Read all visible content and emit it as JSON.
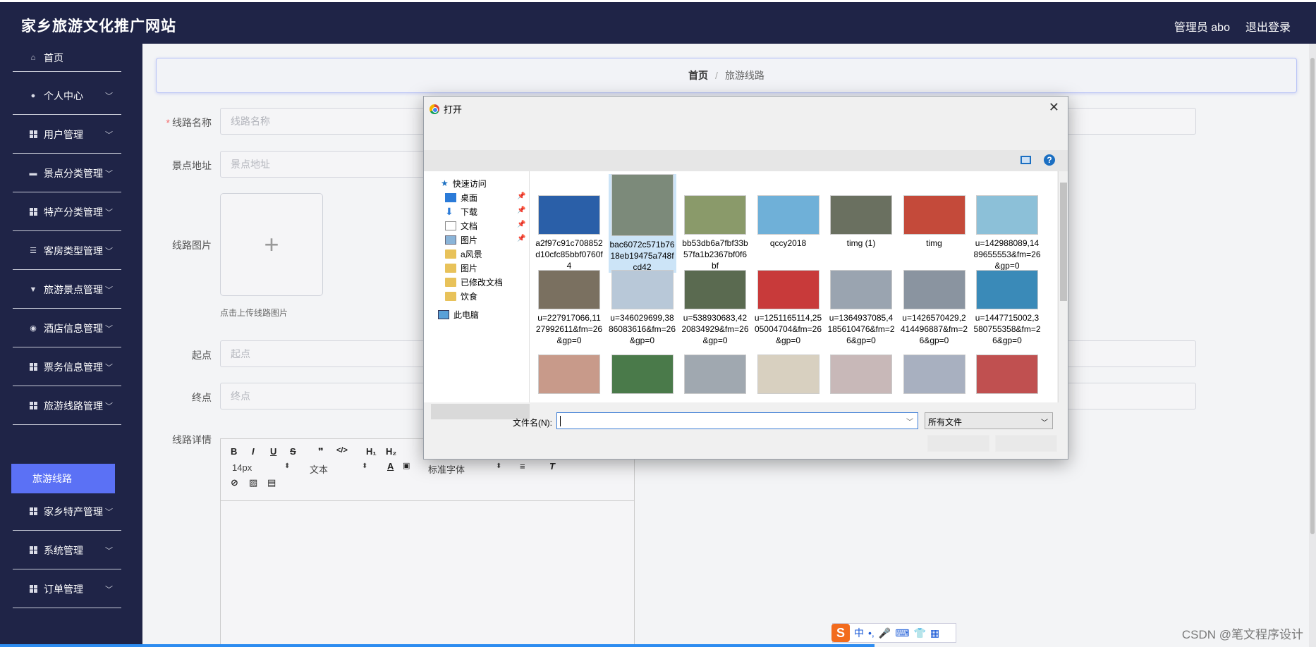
{
  "header": {
    "title": "家乡旅游文化推广网站",
    "user": "管理员 abo",
    "logout": "退出登录"
  },
  "sidebar": {
    "items": [
      {
        "label": "首页"
      },
      {
        "label": "个人中心"
      },
      {
        "label": "用户管理"
      },
      {
        "label": "景点分类管理"
      },
      {
        "label": "特产分类管理"
      },
      {
        "label": "客房类型管理"
      },
      {
        "label": "旅游景点管理"
      },
      {
        "label": "酒店信息管理"
      },
      {
        "label": "票务信息管理"
      },
      {
        "label": "旅游线路管理"
      },
      {
        "label": "家乡特产管理"
      },
      {
        "label": "系统管理"
      },
      {
        "label": "订单管理"
      }
    ],
    "active_sub": "旅游线路"
  },
  "breadcrumb": {
    "home": "首页",
    "sep": "/",
    "current": "旅游线路"
  },
  "form": {
    "name_label": "线路名称",
    "name_placeholder": "线路名称",
    "address_label": "景点地址",
    "address_placeholder": "景点地址",
    "image_label": "线路图片",
    "upload_plus": "+",
    "upload_hint": "点击上传线路图片",
    "start_label": "起点",
    "start_placeholder": "起点",
    "end_label": "终点",
    "end_placeholder": "终点",
    "detail_label": "线路详情"
  },
  "editor": {
    "bold": "B",
    "italic": "I",
    "underline": "U",
    "strike": "S",
    "quote": "❞",
    "code": "</>",
    "h1": "H₁",
    "h2": "H₂",
    "font_size": "14px",
    "text_type": "文本",
    "font_family": "标准字体"
  },
  "dialog": {
    "title": "打开",
    "close": "✕",
    "help": "?",
    "nav": [
      {
        "label": "快速访问"
      },
      {
        "label": "桌面"
      },
      {
        "label": "下载"
      },
      {
        "label": "文档"
      },
      {
        "label": "图片"
      },
      {
        "label": "a风景"
      },
      {
        "label": "图片"
      },
      {
        "label": "已修改文档"
      },
      {
        "label": "饮食"
      },
      {
        "label": "此电脑"
      }
    ],
    "files": [
      {
        "name": "a2f97c91c708852d10cfc85bbf0760f4",
        "color": "#2a5fa8"
      },
      {
        "name": "bac6072c571b7618eb19475a748fcd42",
        "color": "#7c8a7a"
      },
      {
        "name": "bb53db6a7fbf33b57fa1b2367bf0f6bf",
        "color": "#8a9a6a"
      },
      {
        "name": "qccy2018",
        "color": "#6fb0d8"
      },
      {
        "name": "timg (1)",
        "color": "#6a7060"
      },
      {
        "name": "timg",
        "color": "#c44a3a"
      },
      {
        "name": "u=142988089,14896555​53&fm=26&gp=0",
        "color": "#8cc0d8"
      },
      {
        "name": "u=227917066,1127992611&fm=26&gp=0",
        "color": "#7a7060"
      },
      {
        "name": "u=346029699,38860836​16&fm=26&gp=0",
        "color": "#b8c8d8"
      },
      {
        "name": "u=538930683,4220834929&fm=26&gp=0",
        "color": "#5a6a50"
      },
      {
        "name": "u=1251165114,2505004704&fm=26&gp=0",
        "color": "#c83a3a"
      },
      {
        "name": "u=1364937085,4185610476&fm=26&gp=0",
        "color": "#9aa4b0"
      },
      {
        "name": "u=1426570429,2414496887&fm=26&gp=0",
        "color": "#8a94a0"
      },
      {
        "name": "u=1447715002,3580755358&fm=26&gp=0",
        "color": "#3a8ab8"
      },
      {
        "name": "",
        "color": "#c89a8a"
      },
      {
        "name": "",
        "color": "#4a7a4a"
      },
      {
        "name": "",
        "color": "#a0a8b0"
      },
      {
        "name": "",
        "color": "#d8d0c0"
      },
      {
        "name": "",
        "color": "#c8b8b8"
      },
      {
        "name": "",
        "color": "#a8b0c0"
      },
      {
        "name": "",
        "color": "#c05050"
      }
    ],
    "filename_label": "文件名(N):",
    "filename_value": "",
    "filetype": "所有文件"
  },
  "ime": {
    "lang": "中",
    "logo": "S"
  },
  "watermark": "CSDN @笔文程序设计"
}
